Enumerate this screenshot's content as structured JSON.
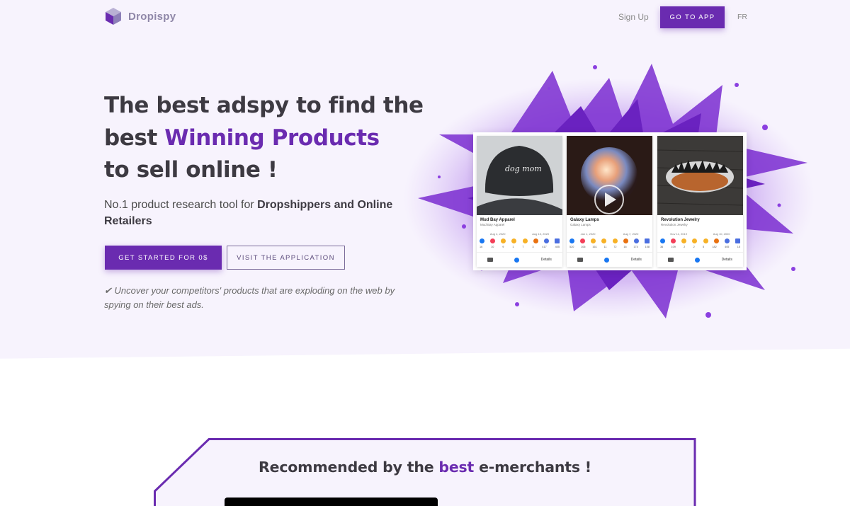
{
  "brand": {
    "name": "Dropispy",
    "accent": "#6a2bb0",
    "hero_bg": "#f7f3fd"
  },
  "nav": {
    "signup": "Sign Up",
    "goto_app": "GO TO APP",
    "lang": "FR"
  },
  "hero": {
    "headline_1": "The best adspy to find the",
    "headline_2a": "best ",
    "headline_2b": "Winning Products",
    "headline_3": "to sell online !",
    "sub_a": "No.1 product research tool for ",
    "sub_b": "Dropshippers and Online Retailers",
    "cta_primary": "GET STARTED FOR 0$",
    "cta_secondary": "VISIT THE APPLICATION",
    "tagline": "✔ Uncover your competitors' products that are exploding on the web by spying on their best ads."
  },
  "cards": [
    {
      "title": "Mud Bay Apparel",
      "subtitle": "Mud Bay Apparel",
      "date_start": "Aug 4, 2020",
      "date_end": "Aug 10, 2020",
      "counts": [
        "16",
        "10",
        "9",
        "1",
        "7",
        "3",
        "417",
        "405"
      ],
      "details": "Details"
    },
    {
      "title": "Galaxy Lamps",
      "subtitle": "Galaxy Lamps",
      "date_start": "Jan 1, 2020",
      "date_end": "Aug 7, 2020",
      "counts": [
        "520",
        "106",
        "161",
        "11",
        "72",
        "16",
        "174",
        "108"
      ],
      "details": "Details"
    },
    {
      "title": "Revolution Jewelry",
      "subtitle": "Revolution Jewelry",
      "date_start": "Nov 11, 2019",
      "date_end": "Aug 10, 2020",
      "counts": [
        "36",
        "109",
        "2",
        "2",
        "5",
        "182",
        "405",
        "15"
      ],
      "details": "Details"
    }
  ],
  "recommended": {
    "title_a": "Recommended by the ",
    "title_b": "best",
    "title_c": " e-merchants !"
  }
}
